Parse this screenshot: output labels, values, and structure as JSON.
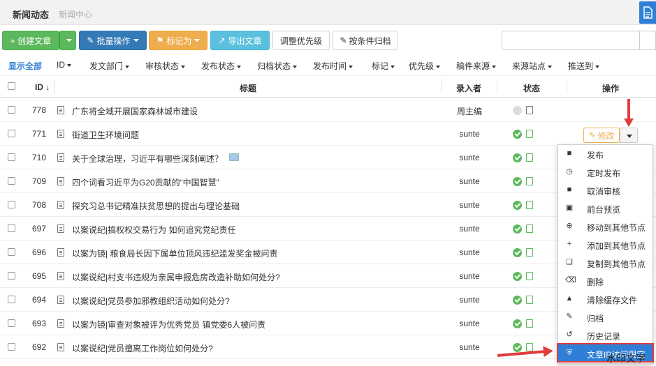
{
  "header": {
    "title": "新闻动态",
    "subtitle": "新闻中心"
  },
  "toolbar": {
    "create": "+ 创建文章",
    "batch": "批量操作",
    "mark": "标记为",
    "export": "导出文章",
    "priority": "调整优先级",
    "archive": "按条件归档",
    "search_placeholder": ""
  },
  "filters": [
    "显示全部",
    "ID",
    "发文部门",
    "审核状态",
    "发布状态",
    "归档状态",
    "发布时间",
    "标记",
    "优先级",
    "稿件来源",
    "来源站点",
    "推送到"
  ],
  "columns": {
    "id": "ID",
    "title": "标题",
    "author": "录入者",
    "status": "状态",
    "action": "操作"
  },
  "rows": [
    {
      "id": "778",
      "title": "广东将全域开展国家森林城市建设",
      "author": "周主编",
      "status": "pending"
    },
    {
      "id": "771",
      "title": "街道卫生环境问题",
      "author": "sunte",
      "status": "published"
    },
    {
      "id": "710",
      "title": "关于全球治理，习近平有哪些深刻阐述？",
      "author": "sunte",
      "status": "published"
    },
    {
      "id": "709",
      "title": "四个词看习近平为G20贡献的“中国智慧”",
      "author": "sunte",
      "status": "published"
    },
    {
      "id": "708",
      "title": "探究习总书记精准扶贫思想的提出与理论基础",
      "author": "sunte",
      "status": "published"
    },
    {
      "id": "697",
      "title": "以案说纪|搞权权交易行为 如何追究党纪责任",
      "author": "sunte",
      "status": "published"
    },
    {
      "id": "696",
      "title": "以案为镜| 粮食局长因下属单位顶风违纪滥发奖金被问责",
      "author": "sunte",
      "status": "published"
    },
    {
      "id": "695",
      "title": "以案说纪|村支书违规为亲属申报危房改造补助如何处分?",
      "author": "sunte",
      "status": "published"
    },
    {
      "id": "694",
      "title": "以案说纪|党员参加邪教组织活动如何处分?",
      "author": "sunte",
      "status": "published"
    },
    {
      "id": "693",
      "title": "以案为镜|审查对象被评为优秀党员 镇党委6人被问责",
      "author": "sunte",
      "status": "published"
    },
    {
      "id": "692",
      "title": "以案说纪|党员擅离工作岗位如何处分?",
      "author": "sunte",
      "status": "published"
    }
  ],
  "edit_label": "修改",
  "menu": [
    {
      "label": "发布",
      "icon": "publish-icon"
    },
    {
      "label": "定时发布",
      "icon": "clock-icon"
    },
    {
      "label": "取消审核",
      "icon": "unaudit-icon"
    },
    {
      "label": "前台预览",
      "icon": "preview-icon"
    },
    {
      "label": "移动到其他节点",
      "icon": "move-icon"
    },
    {
      "label": "添加到其他节点",
      "icon": "plus-icon"
    },
    {
      "label": "复制到其他节点",
      "icon": "copy-icon"
    },
    {
      "label": "删除",
      "icon": "trash-icon"
    },
    {
      "label": "清除缓存文件",
      "icon": "broom-icon"
    },
    {
      "label": "归档",
      "icon": "archive-icon"
    },
    {
      "label": "历史记录",
      "icon": "history-icon"
    },
    {
      "label": "文章IP访问限定",
      "icon": "shield-icon"
    }
  ],
  "watermark": "水印文字",
  "colors": {
    "primary": "#2f7fd6",
    "green": "#5cb85c",
    "orange": "#f0ad4e",
    "cyan": "#5bc0de",
    "blue": "#337ab7",
    "highlight_border": "#e23c3c"
  }
}
